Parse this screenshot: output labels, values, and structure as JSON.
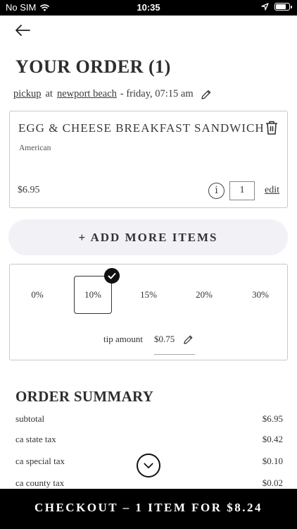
{
  "status_bar": {
    "carrier": "No SIM",
    "time": "10:35",
    "battery_level": 0.8
  },
  "page": {
    "title": "YOUR ORDER (1)"
  },
  "pickup": {
    "mode": "pickup",
    "at": "at",
    "location": "newport beach",
    "when": "- friday, 07:15 am"
  },
  "item": {
    "name": "EGG & CHEESE BREAKFAST SANDWICH",
    "category": "American",
    "price": "$6.95",
    "info": "i",
    "quantity": "1",
    "edit_label": "edit"
  },
  "add_more_label": "+ ADD MORE ITEMS",
  "tip": {
    "options": [
      "0%",
      "10%",
      "15%",
      "20%",
      "30%"
    ],
    "selected": "10%",
    "amount_label": "tip amount",
    "amount": "$0.75"
  },
  "summary": {
    "title": "ORDER SUMMARY",
    "rows": [
      {
        "label": "subtotal",
        "value": "$6.95"
      },
      {
        "label": "ca state tax",
        "value": "$0.42"
      },
      {
        "label": "ca special tax",
        "value": "$0.10"
      },
      {
        "label": "ca county tax",
        "value": "$0.02"
      }
    ]
  },
  "checkout_label": "CHECKOUT – 1 ITEM FOR $8.24"
}
